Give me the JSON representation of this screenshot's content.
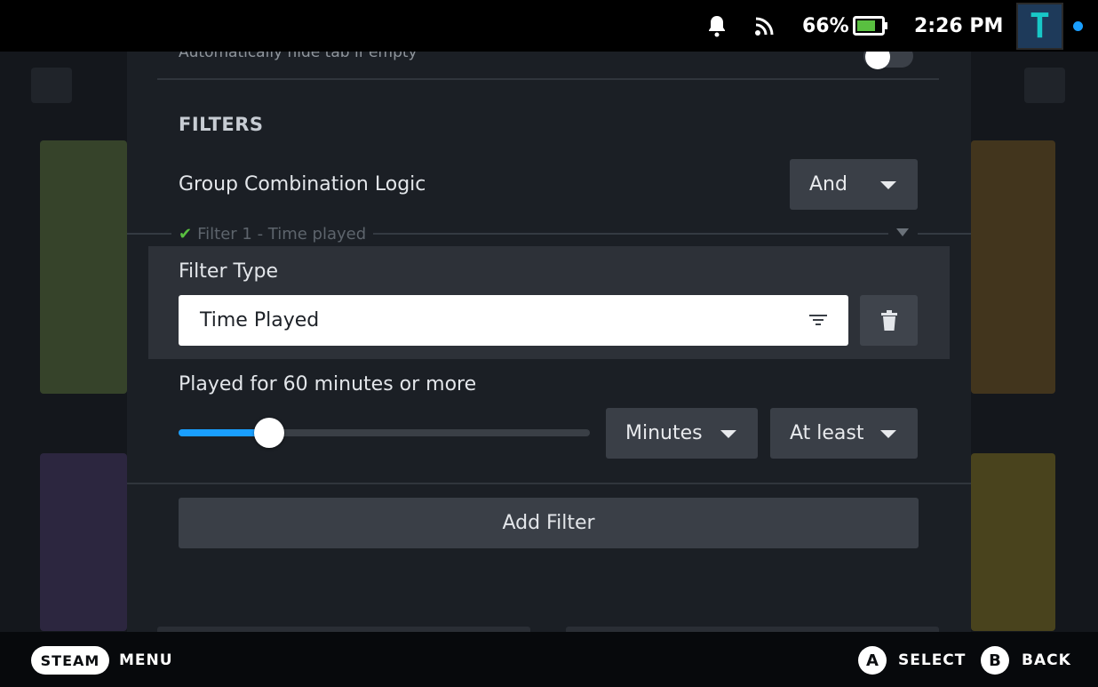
{
  "status_bar": {
    "battery_percent": "66%",
    "time": "2:26 PM",
    "avatar_letter": "T",
    "icons": [
      "bell-icon",
      "wifi-icon",
      "battery-icon"
    ]
  },
  "panel": {
    "top_row_label": "Automatically hide tab if empty",
    "top_row_toggle_on": false,
    "section_heading": "FILTERS",
    "combination": {
      "label": "Group Combination Logic",
      "value": "And"
    },
    "filter1": {
      "legend": "Filter 1 - Time played",
      "type_label": "Filter Type",
      "type_value": "Time Played",
      "description": "Played for 60 minutes or more",
      "slider_fraction": 0.22,
      "unit": "Minutes",
      "comparison": "At least"
    },
    "add_filter_label": "Add Filter"
  },
  "footer": {
    "steam_label": "STEAM",
    "menu_label": "MENU",
    "a_glyph": "A",
    "select_label": "SELECT",
    "b_glyph": "B",
    "back_label": "BACK"
  },
  "colors": {
    "accent": "#1a9fff",
    "panel_bg": "#1b1f25",
    "check_green": "#59bf40"
  }
}
